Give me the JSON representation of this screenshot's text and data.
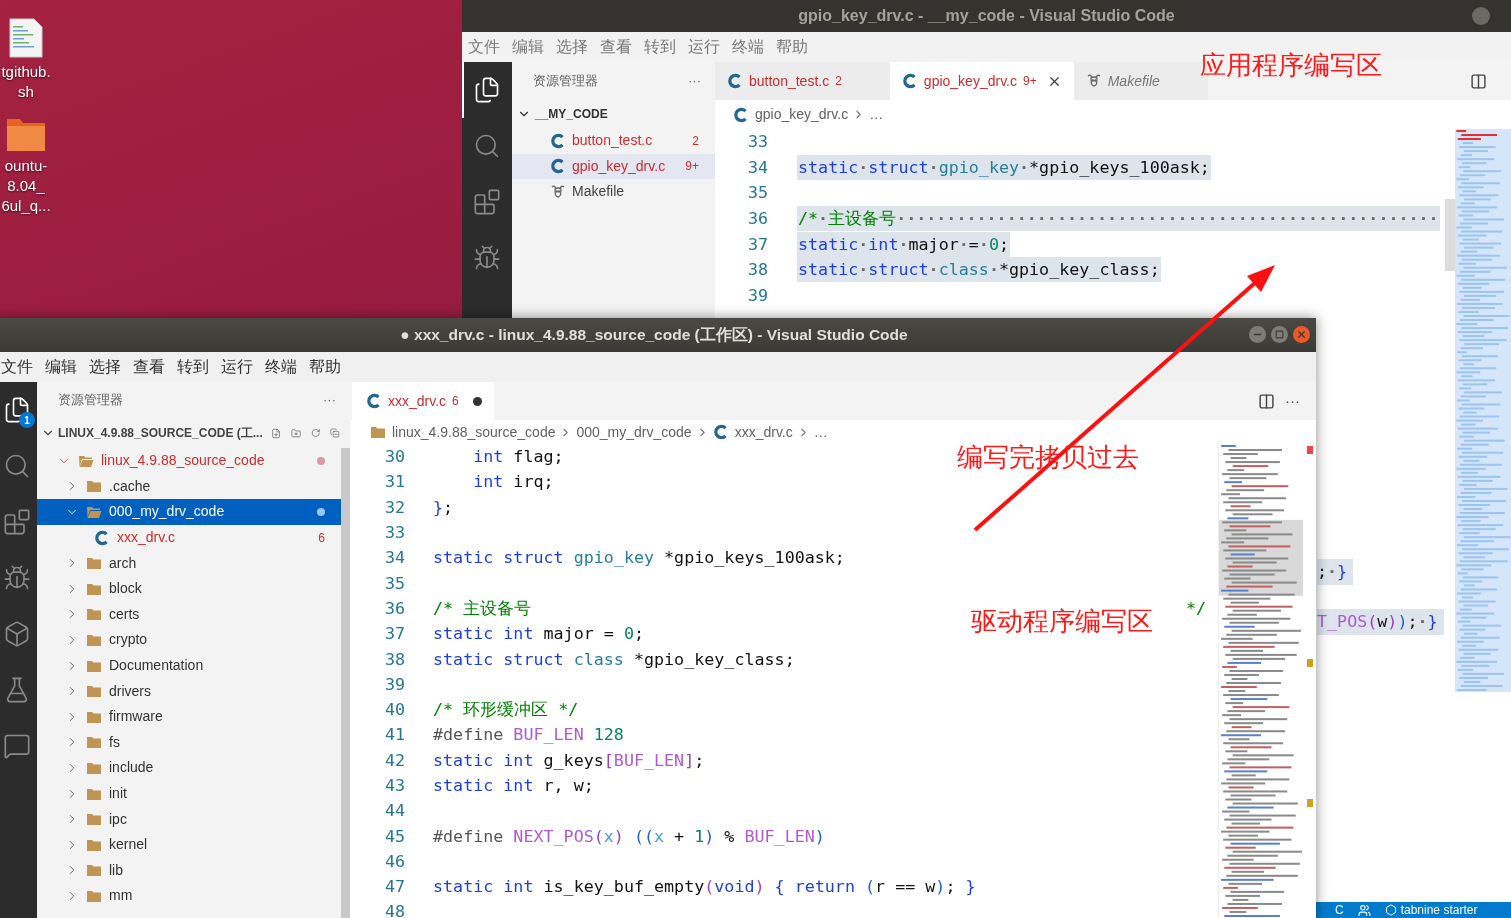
{
  "desktop": {
    "icons": [
      {
        "kind": "file",
        "label_lines": [
          "tgithub.",
          "sh"
        ]
      },
      {
        "kind": "folder",
        "label_lines": [
          "ountu-",
          "8.04_",
          "6ul_q..."
        ]
      }
    ]
  },
  "back_window": {
    "title": "gpio_key_drv.c - __my_code - Visual Studio Code",
    "menu": [
      "文件",
      "编辑",
      "选择",
      "查看",
      "转到",
      "运行",
      "终端",
      "帮助"
    ],
    "activity_bar": [
      {
        "kind": "files",
        "selected": true
      },
      {
        "kind": "search",
        "selected": false
      },
      {
        "kind": "extensions",
        "selected": false
      },
      {
        "kind": "run",
        "selected": false
      }
    ],
    "explorer": {
      "title": "资源管理器",
      "more": "···",
      "root": {
        "label": "__MY_CODE",
        "expanded": true
      },
      "files": [
        {
          "name": "button_test.c",
          "kind": "c_file",
          "badge": "2",
          "has_errors": true,
          "selected": false
        },
        {
          "name": "gpio_key_drv.c",
          "kind": "c_file",
          "badge": "9+",
          "has_errors": true,
          "selected": true
        },
        {
          "name": "Makefile",
          "kind": "makefile",
          "has_errors": false,
          "selected": false
        }
      ]
    },
    "tabs": [
      {
        "label": "button_test.c",
        "kind": "c_file",
        "badge": "2",
        "has_errors": true,
        "selected": false,
        "preview": false
      },
      {
        "label": "gpio_key_drv.c",
        "kind": "c_file",
        "badge": "9+",
        "has_errors": true,
        "selected": true,
        "preview": false
      },
      {
        "label": "Makefile",
        "kind": "makefile",
        "has_errors": false,
        "selected": false,
        "preview": true
      }
    ],
    "breadcrumb": [
      {
        "label": "gpio_key_drv.c",
        "kind": "c_file"
      },
      {
        "label": "…",
        "kind": "plain"
      }
    ],
    "code_lines": [
      {
        "number": "33"
      },
      {
        "number": "34",
        "highlighted": true,
        "tokens": [
          {
            "kind": "kw",
            "text": "static"
          },
          {
            "kind": "ws",
            "text": "·"
          },
          {
            "kind": "kw",
            "text": "struct"
          },
          {
            "kind": "ws",
            "text": "·"
          },
          {
            "kind": "type",
            "text": "gpio_key"
          },
          {
            "kind": "ws",
            "text": "·"
          },
          {
            "kind": "plain",
            "text": "*gpio_keys_100ask;"
          }
        ]
      },
      {
        "number": "35"
      },
      {
        "number": "36",
        "highlighted": true,
        "tokens": [
          {
            "kind": "comment",
            "text": "/*"
          },
          {
            "kind": "ws",
            "text": "·"
          },
          {
            "kind": "comment",
            "text": "主设备号"
          },
          {
            "kind": "ws",
            "text": "······················································"
          }
        ]
      },
      {
        "number": "37",
        "highlighted": true,
        "tokens": [
          {
            "kind": "kw",
            "text": "static"
          },
          {
            "kind": "ws",
            "text": "·"
          },
          {
            "kind": "kw",
            "text": "int"
          },
          {
            "kind": "ws",
            "text": "·"
          },
          {
            "kind": "plain",
            "text": "major"
          },
          {
            "kind": "ws",
            "text": "·"
          },
          {
            "kind": "plain",
            "text": "="
          },
          {
            "kind": "ws",
            "text": "·"
          },
          {
            "kind": "num",
            "text": "0"
          },
          {
            "kind": "plain",
            "text": ";"
          }
        ]
      },
      {
        "number": "38",
        "highlighted": true,
        "tokens": [
          {
            "kind": "kw",
            "text": "static"
          },
          {
            "kind": "ws",
            "text": "·"
          },
          {
            "kind": "kw",
            "text": "struct"
          },
          {
            "kind": "ws",
            "text": "·"
          },
          {
            "kind": "type",
            "text": "class"
          },
          {
            "kind": "ws",
            "text": "·"
          },
          {
            "kind": "plain",
            "text": "*gpio_key_class;"
          }
        ]
      },
      {
        "number": "39"
      }
    ],
    "fragments": [
      {
        "highlighted": true,
        "tokens": [
          {
            "kind": "plain",
            "text": ";"
          },
          {
            "kind": "ws",
            "text": "·"
          },
          {
            "kind": "brace",
            "text": "}"
          }
        ]
      },
      {
        "highlighted": true,
        "tokens": [
          {
            "kind": "macro",
            "text": "T_POS"
          },
          {
            "kind": "paren2",
            "text": "("
          },
          {
            "kind": "plain",
            "text": "w"
          },
          {
            "kind": "paren2",
            "text": ")"
          },
          {
            "kind": "paren",
            "text": ")"
          },
          {
            "kind": "plain",
            "text": ";"
          },
          {
            "kind": "ws",
            "text": "·"
          },
          {
            "kind": "brace",
            "text": "}"
          }
        ]
      }
    ],
    "status_bar": {
      "language": "C",
      "extension": "tabnine starter"
    }
  },
  "front_window": {
    "title": "● xxx_drv.c - linux_4.9.88_source_code (工作区) - Visual Studio Code",
    "menu": [
      "文件",
      "编辑",
      "选择",
      "查看",
      "转到",
      "运行",
      "终端",
      "帮助"
    ],
    "activity_bar": [
      {
        "kind": "files",
        "selected": true,
        "badge": "1"
      },
      {
        "kind": "search",
        "selected": false
      },
      {
        "kind": "extensions",
        "selected": false
      },
      {
        "kind": "run",
        "selected": false
      },
      {
        "kind": "remote",
        "selected": false
      },
      {
        "kind": "testing",
        "selected": false
      },
      {
        "kind": "chat",
        "selected": false
      }
    ],
    "explorer": {
      "title": "资源管理器",
      "more": "···",
      "root": {
        "label": "LINUX_4.9.88_SOURCE_CODE (工...",
        "expanded": true
      },
      "tree": [
        {
          "name": "linux_4.9.88_source_code",
          "kind": "folder",
          "expanded": true,
          "selected": false,
          "has_errors": true,
          "modified": true,
          "children": [
            {
              "name": ".cache",
              "kind": "folder",
              "expanded": false,
              "selected": false,
              "has_errors": false,
              "modified": false
            },
            {
              "name": "000_my_drv_code",
              "kind": "folder",
              "expanded": true,
              "selected": true,
              "has_errors": false,
              "modified": true,
              "children": [
                {
                  "name": "xxx_drv.c",
                  "kind": "c_file",
                  "selected": false,
                  "has_errors": true,
                  "modified": false,
                  "badge": "6"
                }
              ]
            },
            {
              "name": "arch",
              "kind": "folder",
              "expanded": false,
              "selected": false,
              "has_errors": false,
              "modified": false
            },
            {
              "name": "block",
              "kind": "folder",
              "expanded": false,
              "selected": false,
              "has_errors": false,
              "modified": false
            },
            {
              "name": "certs",
              "kind": "folder",
              "expanded": false,
              "selected": false,
              "has_errors": false,
              "modified": false
            },
            {
              "name": "crypto",
              "kind": "folder",
              "expanded": false,
              "selected": false,
              "has_errors": false,
              "modified": false
            },
            {
              "name": "Documentation",
              "kind": "folder",
              "expanded": false,
              "selected": false,
              "has_errors": false,
              "modified": false
            },
            {
              "name": "drivers",
              "kind": "folder",
              "expanded": false,
              "selected": false,
              "has_errors": false,
              "modified": false
            },
            {
              "name": "firmware",
              "kind": "folder",
              "expanded": false,
              "selected": false,
              "has_errors": false,
              "modified": false
            },
            {
              "name": "fs",
              "kind": "folder",
              "expanded": false,
              "selected": false,
              "has_errors": false,
              "modified": false
            },
            {
              "name": "include",
              "kind": "folder",
              "expanded": false,
              "selected": false,
              "has_errors": false,
              "modified": false
            },
            {
              "name": "init",
              "kind": "folder",
              "expanded": false,
              "selected": false,
              "has_errors": false,
              "modified": false
            },
            {
              "name": "ipc",
              "kind": "folder",
              "expanded": false,
              "selected": false,
              "has_errors": false,
              "modified": false
            },
            {
              "name": "kernel",
              "kind": "folder",
              "expanded": false,
              "selected": false,
              "has_errors": false,
              "modified": false
            },
            {
              "name": "lib",
              "kind": "folder",
              "expanded": false,
              "selected": false,
              "has_errors": false,
              "modified": false
            },
            {
              "name": "mm",
              "kind": "folder",
              "expanded": false,
              "selected": false,
              "has_errors": false,
              "modified": false
            }
          ]
        }
      ]
    },
    "tabs": [
      {
        "label": "xxx_drv.c",
        "kind": "c_file",
        "badge": "6",
        "has_errors": true,
        "selected": true,
        "modified": true
      }
    ],
    "more": "···",
    "breadcrumb": [
      {
        "label": "linux_4.9.88_source_code",
        "kind": "folder"
      },
      {
        "label": "000_my_drv_code",
        "kind": "plain"
      },
      {
        "label": "xxx_drv.c",
        "kind": "c_file"
      },
      {
        "label": "…",
        "kind": "plain"
      }
    ],
    "code_lines": [
      {
        "number": "30",
        "tokens": [
          {
            "kind": "kw",
            "text": "    int"
          },
          {
            "kind": "plain",
            "text": " flag;"
          }
        ]
      },
      {
        "number": "31",
        "tokens": [
          {
            "kind": "kw",
            "text": "    int"
          },
          {
            "kind": "plain",
            "text": " irq;"
          }
        ]
      },
      {
        "number": "32",
        "tokens": [
          {
            "kind": "brace",
            "text": "}"
          },
          {
            "kind": "plain",
            "text": ";"
          }
        ]
      },
      {
        "number": "33"
      },
      {
        "number": "34",
        "tokens": [
          {
            "kind": "kw",
            "text": "static struct"
          },
          {
            "kind": "type",
            "text": " gpio_key"
          },
          {
            "kind": "plain",
            "text": " *gpio_keys_100ask;"
          }
        ]
      },
      {
        "number": "35"
      },
      {
        "number": "36",
        "tokens": [
          {
            "kind": "comment",
            "text": "/* 主设备号"
          },
          {
            "kind": "comment_end",
            "text": "*/"
          }
        ]
      },
      {
        "number": "37",
        "tokens": [
          {
            "kind": "kw",
            "text": "static int"
          },
          {
            "kind": "plain",
            "text": " major = "
          },
          {
            "kind": "num",
            "text": "0"
          },
          {
            "kind": "plain",
            "text": ";"
          }
        ]
      },
      {
        "number": "38",
        "tokens": [
          {
            "kind": "kw",
            "text": "static struct"
          },
          {
            "kind": "type",
            "text": " class"
          },
          {
            "kind": "plain",
            "text": " *gpio_key_class;"
          }
        ]
      },
      {
        "number": "39"
      },
      {
        "number": "40",
        "tokens": [
          {
            "kind": "comment",
            "text": "/* 环形缓冲区 */"
          }
        ]
      },
      {
        "number": "41",
        "tokens": [
          {
            "kind": "pre",
            "text": "#define"
          },
          {
            "kind": "macro",
            "text": " BUF_LEN"
          },
          {
            "kind": "num",
            "text": " 128"
          }
        ]
      },
      {
        "number": "42",
        "tokens": [
          {
            "kind": "kw",
            "text": "static int"
          },
          {
            "kind": "plain",
            "text": " g_keys"
          },
          {
            "kind": "paren2",
            "text": "["
          },
          {
            "kind": "macro",
            "text": "BUF_LEN"
          },
          {
            "kind": "paren2",
            "text": "]"
          },
          {
            "kind": "plain",
            "text": ";"
          }
        ]
      },
      {
        "number": "43",
        "tokens": [
          {
            "kind": "kw",
            "text": "static int"
          },
          {
            "kind": "plain",
            "text": " r, w;"
          }
        ]
      },
      {
        "number": "44"
      },
      {
        "number": "45",
        "tokens": [
          {
            "kind": "pre",
            "text": "#define"
          },
          {
            "kind": "macro",
            "text": " NEXT_POS"
          },
          {
            "kind": "paren2",
            "text": "("
          },
          {
            "kind": "param",
            "text": "x"
          },
          {
            "kind": "paren2",
            "text": ")"
          },
          {
            "kind": "paren",
            "text": " (("
          },
          {
            "kind": "param",
            "text": "x"
          },
          {
            "kind": "plain",
            "text": " + "
          },
          {
            "kind": "num",
            "text": "1"
          },
          {
            "kind": "paren",
            "text": ")"
          },
          {
            "kind": "plain",
            "text": " % "
          },
          {
            "kind": "macro",
            "text": "BUF_LEN"
          },
          {
            "kind": "paren",
            "text": ")"
          }
        ]
      },
      {
        "number": "46"
      },
      {
        "number": "47",
        "tokens": [
          {
            "kind": "kw",
            "text": "static int"
          },
          {
            "kind": "plain",
            "text": " is_key_buf_empty"
          },
          {
            "kind": "paren2",
            "text": "("
          },
          {
            "kind": "kw",
            "text": "void"
          },
          {
            "kind": "paren2",
            "text": ")"
          },
          {
            "kind": "brace",
            "text": " {"
          },
          {
            "kind": "kw",
            "text": " return"
          },
          {
            "kind": "paren",
            "text": " ("
          },
          {
            "kind": "plain",
            "text": "r == w"
          },
          {
            "kind": "paren",
            "text": ")"
          },
          {
            "kind": "plain",
            "text": "; "
          },
          {
            "kind": "brace",
            "text": "}"
          }
        ]
      },
      {
        "number": "48"
      }
    ]
  },
  "annotations": [
    {
      "text": "应用程序编写区"
    },
    {
      "text": "编写完拷贝过去"
    },
    {
      "text": "驱动程序编写区"
    }
  ]
}
